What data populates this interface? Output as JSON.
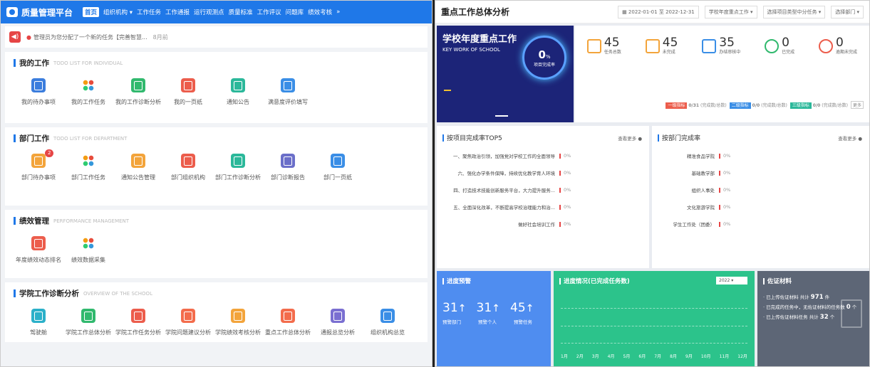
{
  "left": {
    "app_title": "质量管理平台",
    "nav": [
      "首页",
      "组织机构 ▾",
      "工作任务",
      "工作通报",
      "运行观测点",
      "质量标准",
      "工作评议",
      "问题库",
      "绩效考核",
      "»"
    ],
    "notice": {
      "text": "管理员为您分配了一个新的任务【完善智慧...",
      "time": "8月前"
    },
    "sections": [
      {
        "title": "我的工作",
        "subtitle": "TODO LIST FOR INDIVIDUAL",
        "items": [
          {
            "label": "我的待办事项",
            "icon": "document-icon",
            "color": "#3b7ddd"
          },
          {
            "label": "我的工作任务",
            "icon": "dots-grid-icon",
            "color": ""
          },
          {
            "label": "我的工作诊断分析",
            "icon": "analysis-icon",
            "color": "#31b96e"
          },
          {
            "label": "我的一页纸",
            "icon": "page-icon",
            "color": "#ec5d4c"
          },
          {
            "label": "通知公告",
            "icon": "notice-icon",
            "color": "#2bb89a"
          },
          {
            "label": "满意度评价填写",
            "icon": "evaluation-icon",
            "color": "#3a8ee6"
          }
        ]
      },
      {
        "title": "部门工作",
        "subtitle": "TODO LIST FOR DEPARTMENT",
        "items": [
          {
            "label": "部门待办事项",
            "icon": "document-icon",
            "color": "#f3a43b",
            "badge": "2"
          },
          {
            "label": "部门工作任务",
            "icon": "dots-grid-icon",
            "color": ""
          },
          {
            "label": "通知公告管理",
            "icon": "notice-icon",
            "color": "#f3a43b"
          },
          {
            "label": "部门组织机构",
            "icon": "org-icon",
            "color": "#ec5d4c"
          },
          {
            "label": "部门工作诊断分析",
            "icon": "analysis-icon",
            "color": "#2bb89a"
          },
          {
            "label": "部门诊断报告",
            "icon": "report-icon",
            "color": "#6b6fc9"
          },
          {
            "label": "部门一页纸",
            "icon": "page-icon",
            "color": "#3a8ee6"
          }
        ]
      },
      {
        "title": "绩效管理",
        "subtitle": "PERFORMANCE MANAGEMENT",
        "items": [
          {
            "label": "年度绩效动态排名",
            "icon": "ranking-icon",
            "color": "#ec5d4c"
          },
          {
            "label": "绩效数据采集",
            "icon": "dots-grid-icon",
            "color": ""
          }
        ]
      },
      {
        "title": "学院工作诊断分析",
        "subtitle": "OVERVIEW OF THE SCHOOL",
        "items": [
          {
            "label": "驾驶舱",
            "icon": "cockpit-icon",
            "color": "#2bb0c9"
          },
          {
            "label": "学院工作总体分析",
            "icon": "pie-icon",
            "color": "#31b96e"
          },
          {
            "label": "学院工作任务分析",
            "icon": "task-icon",
            "color": "#ec5d4c"
          },
          {
            "label": "学院问题建议分析",
            "icon": "issue-icon",
            "color": "#f36c4c"
          },
          {
            "label": "学院绩效考核分析",
            "icon": "medal-icon",
            "color": "#f3a43b"
          },
          {
            "label": "重点工作总体分析",
            "icon": "key-work-icon",
            "color": "#f36c4c"
          },
          {
            "label": "通报总览分析",
            "icon": "layers-icon",
            "color": "#7a6fd1"
          },
          {
            "label": "组织机构总览",
            "icon": "structure-icon",
            "color": "#3a8ee6"
          }
        ]
      }
    ]
  },
  "right": {
    "title": "重点工作总体分析",
    "date_from": "2022-01-01",
    "date_sep": "至",
    "date_to": "2022-12-31",
    "year_select": "学校年度重点工作",
    "project_select": "选择项目类型中分任务",
    "dept_select": "选择部门",
    "hero": {
      "title": "学校年度重点工作",
      "subtitle": "KEY WORK OF SCHOOL",
      "rate": "0",
      "rate_unit": "%",
      "rate_label": "项目完成率"
    },
    "stats": [
      {
        "value": "45",
        "label": "任务总数",
        "icon": "chart-icon",
        "color": "#f3a43b"
      },
      {
        "value": "45",
        "label": "未完成",
        "icon": "list-icon",
        "color": "#f3a43b"
      },
      {
        "value": "35",
        "label": "办结审核中",
        "icon": "edit-icon",
        "color": "#3a8ee6"
      },
      {
        "value": "0",
        "label": "已完成",
        "icon": "check-icon",
        "color": "#31b96e"
      },
      {
        "value": "0",
        "label": "逾期未完成",
        "icon": "alert-icon",
        "color": "#ec5d4c"
      }
    ],
    "levels": [
      {
        "tag": "一级指标",
        "value": "0/31",
        "note": "(完成数/总数)",
        "color": "#ec5d4c"
      },
      {
        "tag": "二级指标",
        "value": "0/0",
        "note": "(完成数/总数)",
        "color": "#3a8ee6"
      },
      {
        "tag": "三级指标",
        "value": "0/0",
        "note": "(完成数/总数)",
        "color": "#2bb89a"
      }
    ],
    "levels_extra": "更多",
    "top5": {
      "title": "按项目完成率TOP5",
      "more": "查看更多",
      "rows": [
        {
          "label": "一、聚焦政治引领，加强党对学校工作的全面领导",
          "pct": "0%"
        },
        {
          "label": "六、强化办学条件保障，持续优化教学育人环境",
          "pct": "0%"
        },
        {
          "label": "四、打造技术技能创新服务平台，大力提升服务...",
          "pct": "0%"
        },
        {
          "label": "五、全面深化改革，不断提高学校治理能力和治...",
          "pct": "0%"
        },
        {
          "label": "做好社会培训工作",
          "pct": "0%"
        }
      ]
    },
    "dept": {
      "title": "按部门完成率",
      "more": "查看更多",
      "rows": [
        {
          "label": "精准食品学院",
          "pct": "0%"
        },
        {
          "label": "基础教学部",
          "pct": "0%"
        },
        {
          "label": "组织人事处",
          "pct": "0%"
        },
        {
          "label": "文化旅游学院",
          "pct": "0%"
        },
        {
          "label": "学生工作处（团委）",
          "pct": "0%"
        }
      ]
    },
    "warning": {
      "title": "进度预警",
      "values": [
        "31",
        "31",
        "45"
      ],
      "labels": [
        "预警部门",
        "预警个人",
        "预警任务"
      ]
    },
    "progress": {
      "title": "进度情况(已完成任务数)",
      "year": "2022",
      "months": [
        "1月",
        "2月",
        "3月",
        "4月",
        "5月",
        "6月",
        "7月",
        "8月",
        "9月",
        "10月",
        "11月",
        "12月"
      ]
    },
    "evidence": {
      "title": "佐证材料",
      "lines": [
        {
          "pre": "已上传佐证材料 共计",
          "num": "971",
          "post": "件"
        },
        {
          "pre": "已完成的任务中，无佐证材料的任务数",
          "num": "0",
          "post": "个"
        },
        {
          "pre": "已上传佐证材料任务 共计",
          "num": "32",
          "post": "个"
        }
      ]
    }
  }
}
